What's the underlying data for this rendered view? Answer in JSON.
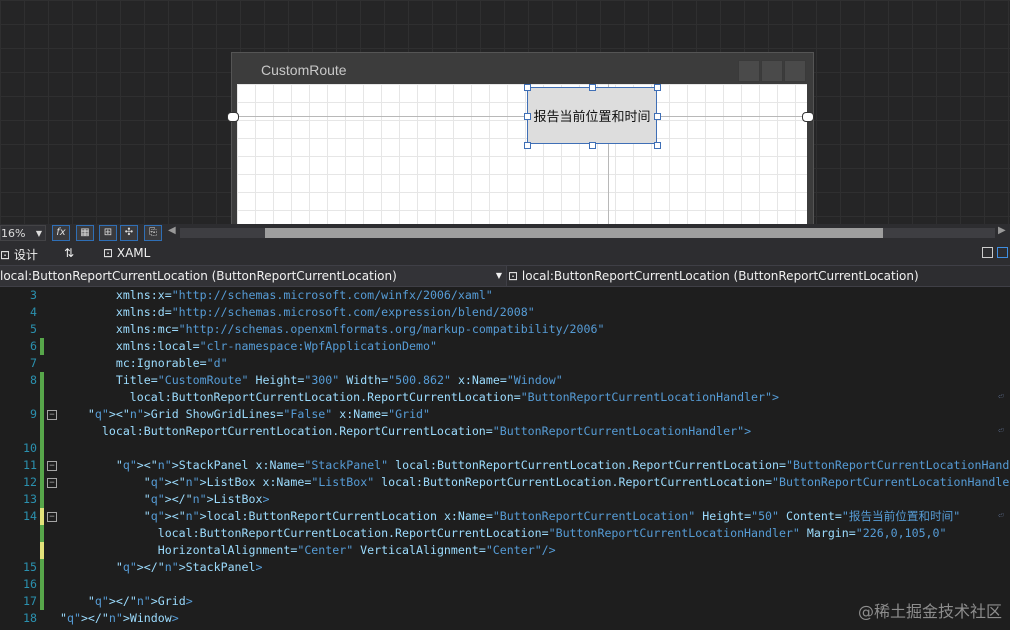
{
  "designer": {
    "window_title": "CustomRoute",
    "button_content": "报告当前位置和时间"
  },
  "toolbar": {
    "zoom": "16%",
    "fx_label": "fx"
  },
  "tabs": {
    "design": "设计",
    "swap": "⇅",
    "xaml": "XAML"
  },
  "nav": {
    "left": "local:ButtonReportCurrentLocation (ButtonReportCurrentLocation)",
    "right": "local:ButtonReportCurrentLocation (ButtonReportCurrentLocation)"
  },
  "code_lines": [
    {
      "num": "3",
      "change": "",
      "text": "        xmlns:x=\"http://schemas.microsoft.com/winfx/2006/xaml\""
    },
    {
      "num": "4",
      "change": "",
      "text": "        xmlns:d=\"http://schemas.microsoft.com/expression/blend/2008\""
    },
    {
      "num": "5",
      "change": "",
      "text": "        xmlns:mc=\"http://schemas.openxmlformats.org/markup-compatibility/2006\""
    },
    {
      "num": "6",
      "change": "green",
      "text": "        xmlns:local=\"clr-namespace:WpfApplicationDemo\""
    },
    {
      "num": "7",
      "change": "",
      "text": "        mc:Ignorable=\"d\""
    },
    {
      "num": "8",
      "change": "green",
      "text": "        Title=\"CustomRoute\" Height=\"300\" Width=\"500.862\" x:Name=\"Window\""
    },
    {
      "num": "",
      "change": "green",
      "text": "          local:ButtonReportCurrentLocation.ReportCurrentLocation=\"ButtonReportCurrentLocationHandler\">"
    },
    {
      "num": "9",
      "change": "green",
      "text": "    <Grid ShowGridLines=\"False\" x:Name=\"Grid\""
    },
    {
      "num": "",
      "change": "green",
      "text": "      local:ButtonReportCurrentLocation.ReportCurrentLocation=\"ButtonReportCurrentLocationHandler\">"
    },
    {
      "num": "10",
      "change": "green",
      "text": ""
    },
    {
      "num": "11",
      "change": "green",
      "text": "        <StackPanel x:Name=\"StackPanel\" local:ButtonReportCurrentLocation.ReportCurrentLocation=\"ButtonReportCurrentLocationHandler\">"
    },
    {
      "num": "12",
      "change": "green",
      "text": "            <ListBox x:Name=\"ListBox\" local:ButtonReportCurrentLocation.ReportCurrentLocation=\"ButtonReportCurrentLocationHandler\">"
    },
    {
      "num": "13",
      "change": "green",
      "text": "            </ListBox>"
    },
    {
      "num": "14",
      "change": "yellow",
      "text": "            <local:ButtonReportCurrentLocation x:Name=\"ButtonReportCurrentLocation\" Height=\"50\" Content=\"报告当前位置和时间\""
    },
    {
      "num": "",
      "change": "green",
      "text": "              local:ButtonReportCurrentLocation.ReportCurrentLocation=\"ButtonReportCurrentLocationHandler\" Margin=\"226,0,105,0\""
    },
    {
      "num": "",
      "change": "yellow",
      "text": "              HorizontalAlignment=\"Center\" VerticalAlignment=\"Center\"/>"
    },
    {
      "num": "15",
      "change": "green",
      "text": "        </StackPanel>"
    },
    {
      "num": "16",
      "change": "green",
      "text": ""
    },
    {
      "num": "17",
      "change": "green",
      "text": "    </Grid>"
    },
    {
      "num": "18",
      "change": "",
      "text": "</Window>"
    }
  ],
  "watermark": "@稀土掘金技术社区",
  "colors": {
    "editor_bg": "#1e1e1e",
    "line_number": "#2b91af",
    "change_green": "#57a64a",
    "change_yellow": "#e2e27a"
  }
}
